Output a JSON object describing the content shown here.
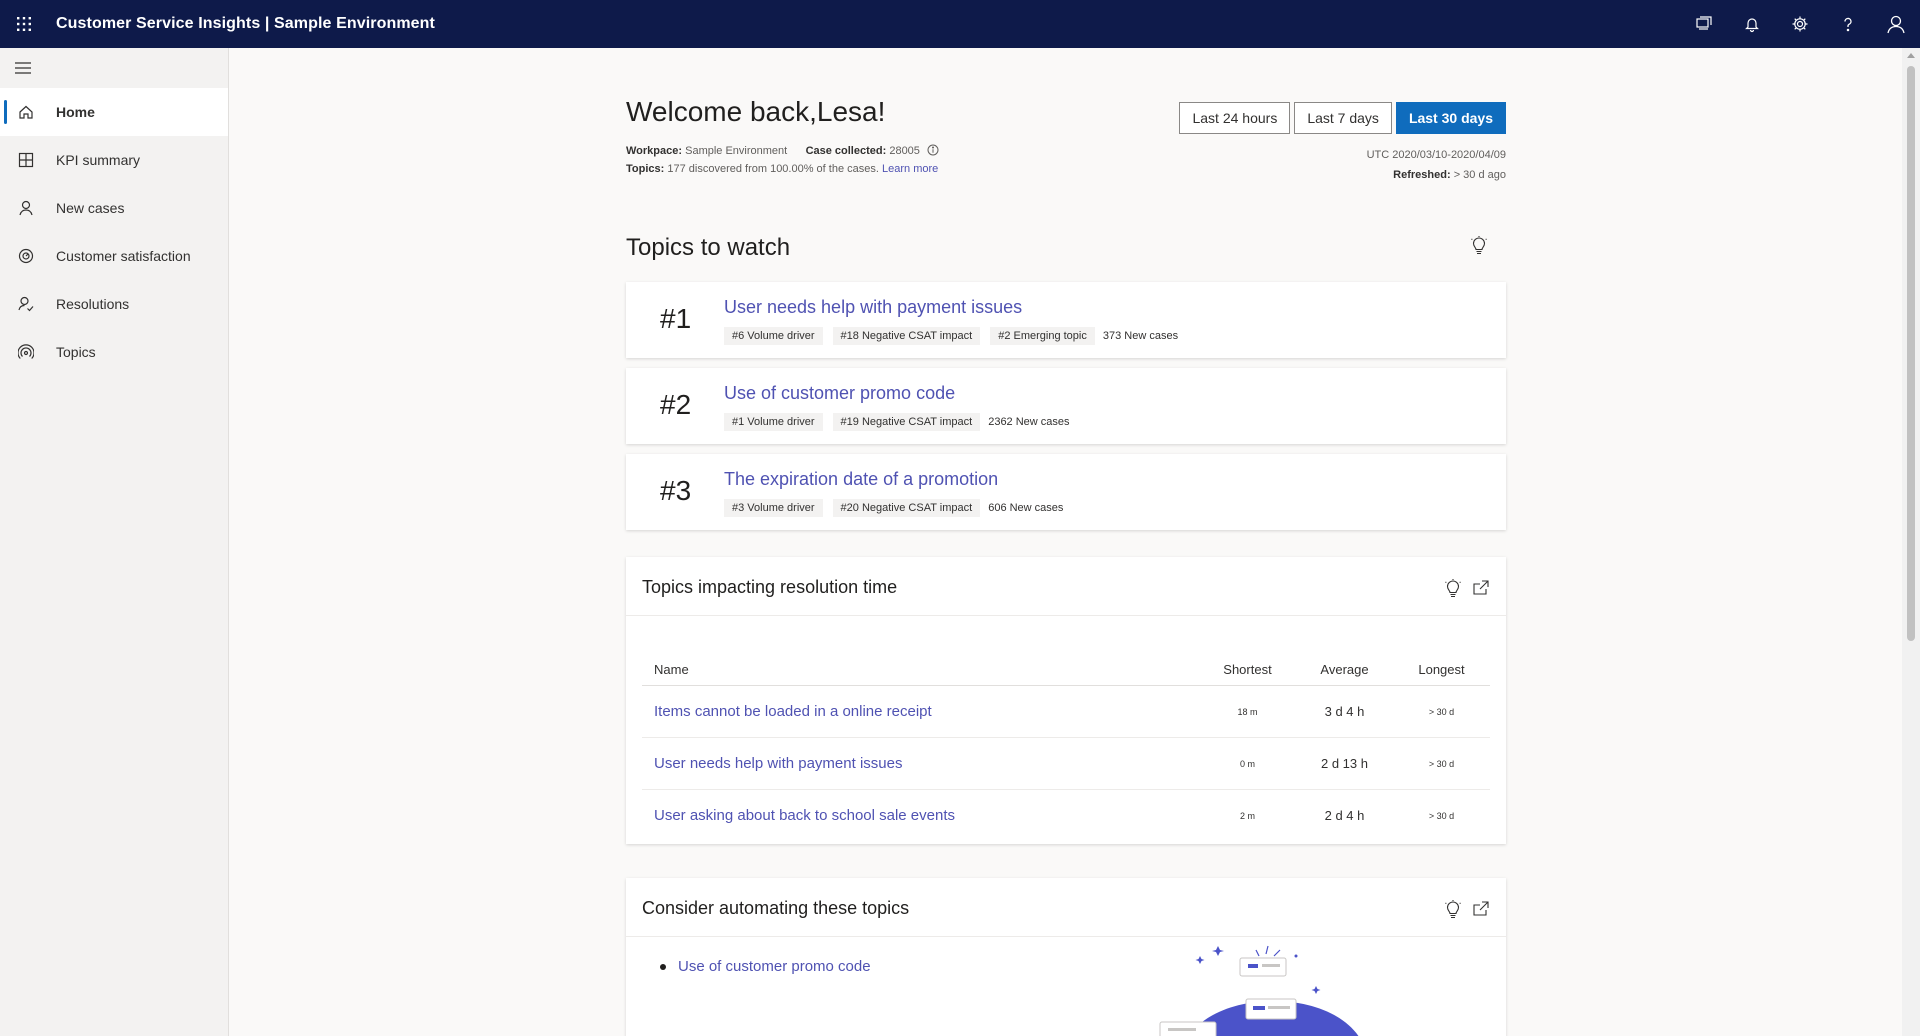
{
  "app": {
    "title": "Customer Service Insights | Sample Environment"
  },
  "topbar": {
    "icons": [
      "chat-icon",
      "bell-icon",
      "gear-icon",
      "help-icon",
      "user-icon"
    ]
  },
  "sidebar": {
    "items": [
      {
        "label": "Home",
        "icon": "home-icon",
        "active": true
      },
      {
        "label": "KPI summary",
        "icon": "grid-icon",
        "active": false
      },
      {
        "label": "New cases",
        "icon": "person-icon",
        "active": false
      },
      {
        "label": "Customer satisfaction",
        "icon": "satisfaction-icon",
        "active": false
      },
      {
        "label": "Resolutions",
        "icon": "resolutions-icon",
        "active": false
      },
      {
        "label": "Topics",
        "icon": "topics-icon",
        "active": false
      }
    ]
  },
  "header": {
    "welcome": "Welcome back,Lesa!",
    "workspace_label": "Workpace:",
    "workspace_value": "Sample Environment",
    "case_label": "Case collected:",
    "case_value": "28005",
    "topics_label": "Topics:",
    "topics_value": "177 discovered from 100.00% of the cases.",
    "learn_more": "Learn more",
    "ranges": [
      "Last 24 hours",
      "Last 7 days",
      "Last 30 days"
    ],
    "selected_range": "Last 30 days",
    "date_range": "UTC 2020/03/10-2020/04/09",
    "refreshed_label": "Refreshed:",
    "refreshed_value": "> 30 d ago"
  },
  "topics_to_watch": {
    "title": "Topics to watch",
    "cards": [
      {
        "rank": "#1",
        "name": "User needs help with payment issues",
        "tags": [
          "#6 Volume driver",
          "#18 Negative CSAT impact",
          "#2 Emerging topic"
        ],
        "new_cases": "373 New cases"
      },
      {
        "rank": "#2",
        "name": "Use of customer promo code",
        "tags": [
          "#1 Volume driver",
          "#19 Negative CSAT impact"
        ],
        "new_cases": "2362 New cases"
      },
      {
        "rank": "#3",
        "name": "The expiration date of a promotion",
        "tags": [
          "#3 Volume driver",
          "#20 Negative CSAT impact"
        ],
        "new_cases": "606 New cases"
      }
    ]
  },
  "resolution_panel": {
    "title": "Topics impacting resolution time",
    "columns": [
      "Name",
      "Shortest",
      "Average",
      "Longest"
    ],
    "rows": [
      {
        "name": "Items cannot be loaded in a online receipt",
        "shortest": "18 m",
        "average": "3 d 4 h",
        "longest": "> 30 d"
      },
      {
        "name": "User needs help with payment issues",
        "shortest": "0 m",
        "average": "2 d 13 h",
        "longest": "> 30 d"
      },
      {
        "name": "User asking about back to school sale events",
        "shortest": "2 m",
        "average": "2 d 4 h",
        "longest": "> 30 d"
      }
    ]
  },
  "automation_panel": {
    "title": "Consider automating these topics",
    "items": [
      "Use of customer promo code"
    ]
  },
  "colors": {
    "topbar": "#0e1a4a",
    "accent": "#0f6cbd",
    "link": "#4f52b2",
    "illustration": "#4b53c9"
  }
}
